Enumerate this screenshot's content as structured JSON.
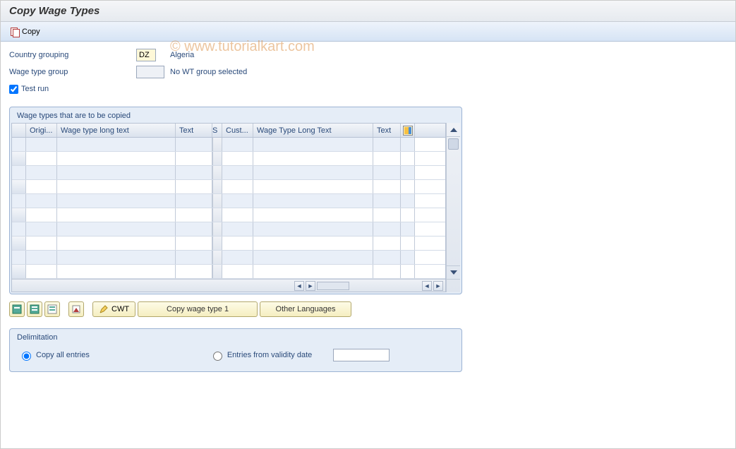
{
  "title": "Copy Wage Types",
  "toolbar": {
    "copy_label": "Copy"
  },
  "form": {
    "country_grouping_label": "Country grouping",
    "country_grouping_value": "DZ",
    "country_grouping_text": "Algeria",
    "wage_type_group_label": "Wage type group",
    "wage_type_group_value": "",
    "wage_type_group_text": "No WT group selected",
    "test_run_label": "Test run",
    "test_run_checked": true
  },
  "table": {
    "title": "Wage types that are to be copied",
    "columns": [
      "Origi...",
      "Wage type long text",
      "Text",
      "S",
      "Cust...",
      "Wage Type Long Text",
      "Text"
    ],
    "row_count": 10
  },
  "buttons": {
    "cwt": "CWT",
    "copy_wage_type_1": "Copy wage type 1",
    "other_languages": "Other Languages"
  },
  "delimitation": {
    "title": "Delimitation",
    "copy_all": "Copy all entries",
    "entries_from": "Entries from validity date",
    "date_value": ""
  },
  "watermark": "© www.tutorialkart.com"
}
